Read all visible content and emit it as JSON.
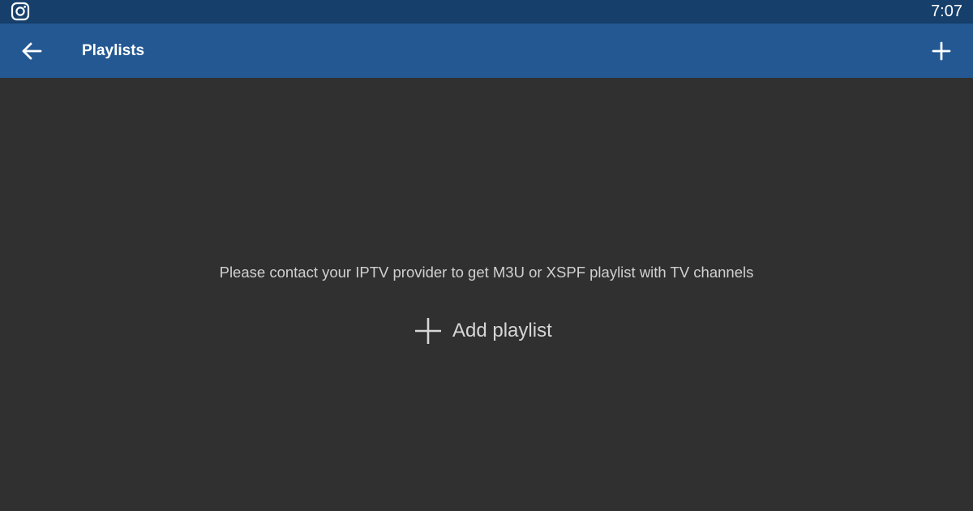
{
  "status_bar": {
    "time": "7:07",
    "left_icon": "instagram-icon"
  },
  "app_bar": {
    "title": "Playlists",
    "back_icon": "arrow-left-icon",
    "action_icon": "plus-icon"
  },
  "empty_state": {
    "message": "Please contact your IPTV provider to get M3U or XSPF playlist with TV channels",
    "add_button_label": "Add playlist",
    "add_button_icon": "plus-icon"
  },
  "colors": {
    "status_bar": "#163f6b",
    "app_bar": "#235893",
    "background": "#303030",
    "text_light": "#d0d0d0"
  }
}
